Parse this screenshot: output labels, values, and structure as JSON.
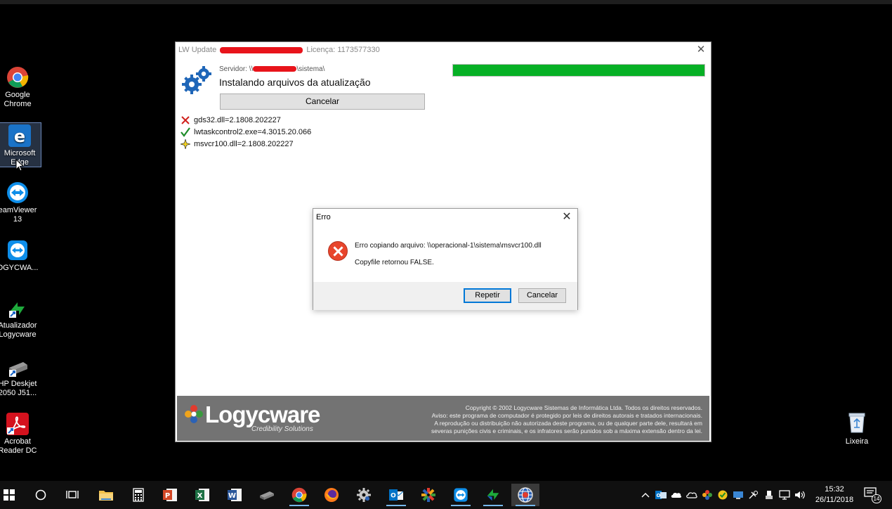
{
  "desktop": {
    "icons": [
      {
        "label": "Google Chrome"
      },
      {
        "label": "Microsoft Edge"
      },
      {
        "label": "eamViewer 13"
      },
      {
        "label": "OGYCWA..."
      },
      {
        "label": "Atualizador Logycware"
      },
      {
        "label": "HP Deskjet 2050 J51..."
      },
      {
        "label": "Acrobat Reader DC"
      }
    ],
    "recycle_bin": {
      "label": "Lixeira"
    }
  },
  "main_window": {
    "title_prefix": "LW Update",
    "title_suffix": "Licença: 1173577330",
    "server_prefix": "Servidor: \\\\",
    "server_suffix": "\\sistema\\",
    "status_heading": "Instalando arquivos da atualização",
    "cancel_label": "Cancelar",
    "progress_percent": 100,
    "files": [
      {
        "status": "error",
        "name": "gds32.dll=2.1808.202227"
      },
      {
        "status": "done",
        "name": "lwtaskcontrol2.exe=4.3015.20.066"
      },
      {
        "status": "in-progress",
        "name": "msvcr100.dll=2.1808.202227"
      }
    ],
    "footer": {
      "logo_word": "Logycware",
      "logo_tagline": "Credibility Solutions",
      "copyright_lines": [
        "Copyright © 2002 Logycware Sistemas de Informática Ltda. Todos os direitos reservados.",
        "Aviso: este programa de computador é protegido por leis de direitos autorais e tratados internacionais.",
        "A reprodução ou distribuição não autorizada deste programa, ou de qualquer parte dele, resultará em",
        "severas punições civis e criminais, e os infratores serão punidos sob a máxima extensão dentro da lei."
      ]
    }
  },
  "error_dialog": {
    "title": "Erro",
    "message_line1": "Erro copiando arquivo: \\\\operacional-1\\sistema\\msvcr100.dll",
    "message_line2": "Copyfile retornou FALSE.",
    "retry_label": "Repetir",
    "cancel_label": "Cancelar"
  },
  "taskbar": {
    "clock_time": "15:32",
    "clock_date": "26/11/2018",
    "notification_count": "14"
  },
  "colors": {
    "progress": "#06b025",
    "accent": "#0078d7",
    "error": "#e8452c",
    "footer": "#737373"
  }
}
